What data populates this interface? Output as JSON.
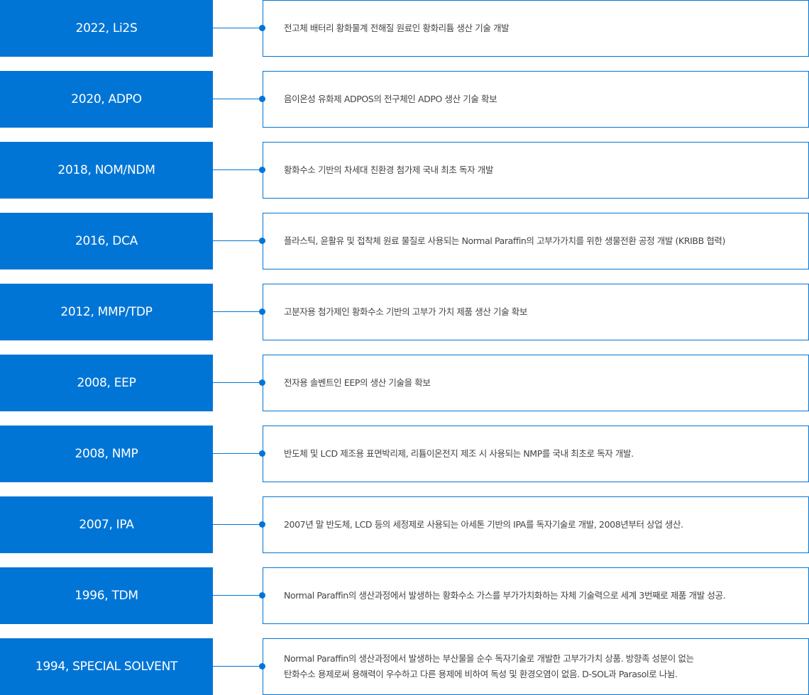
{
  "colors": {
    "accent": "#0175d6",
    "text": "#444444",
    "background": "#ffffff"
  },
  "timeline": [
    {
      "year_label": "2022, Li2S",
      "description": "전고체 배터리 황화물계 전해질 원료인 황화리튬 생산 기술 개발"
    },
    {
      "year_label": "2020, ADPO",
      "description": "음이온성 유화제 ADPOS의 전구체인 ADPO 생산 기술 확보"
    },
    {
      "year_label": "2018, NOM/NDM",
      "description": "황화수소 기반의 차세대 친환경 첨가제 국내 최초 독자 개발"
    },
    {
      "year_label": "2016, DCA",
      "description": "플라스틱, 윤활유 및 접착체 원료 물질로 사용되는 Normal Paraffin의 고부가가치를 위한 생물전환 공정 개발 (KRIBB 협력)"
    },
    {
      "year_label": "2012, MMP/TDP",
      "description": "고분자용 첨가제인 황화수소 기반의 고부가 가치 제품 생산 기술 확보"
    },
    {
      "year_label": "2008, EEP",
      "description": "전자용 솔벤트인 EEP의 생산 기술을 확보"
    },
    {
      "year_label": "2008, NMP",
      "description": "반도체 및 LCD 제조용 표면박리제, 리튬이온전지 제조 시 사용되는 NMP를 국내 최초로 독자 개발."
    },
    {
      "year_label": "2007, IPA",
      "description": "2007년 말 반도체, LCD 등의 세정제로 사용되는 아세톤 기반의 IPA를 독자기술로 개발, 2008년부터 상업 생산."
    },
    {
      "year_label": "1996, TDM",
      "description": "Normal Paraffin의 생산과정에서 발생하는 황화수소 가스를 부가가치화하는 자체 기술력으로 세계 3번째로 제품 개발 성공."
    },
    {
      "year_label": "1994, SPECIAL SOLVENT",
      "description": "Normal Paraffin의 생산과정에서 발생하는 부산물을 순수 독자기술로 개발한 고부가가치 상품. 방향족 성분이 없는\n탄화수소 용제로써 용해력이 우수하고 다른 용제에 비하여 독성 및 환경오염이 없음. D-SOL과 Parasol로 나뉨."
    }
  ]
}
